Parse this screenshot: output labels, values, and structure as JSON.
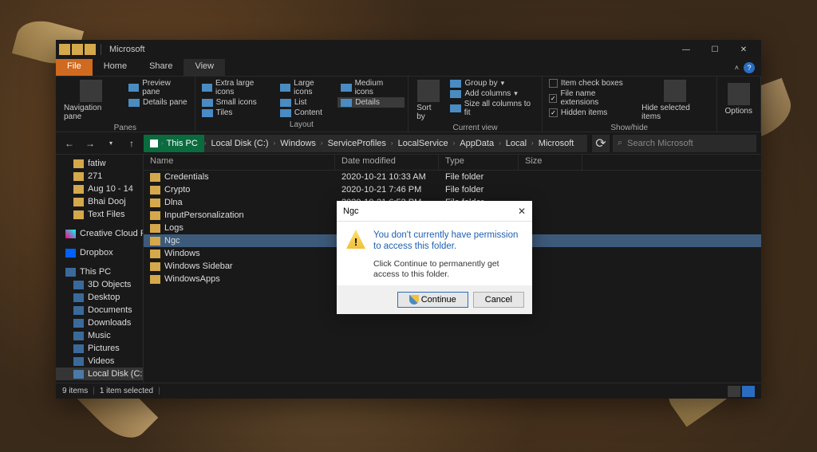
{
  "window": {
    "title": "Microsoft",
    "tabs": [
      "File",
      "Home",
      "Share",
      "View"
    ],
    "active_tab": "View"
  },
  "ribbon": {
    "panes": {
      "nav": "Navigation pane",
      "preview": "Preview pane",
      "details": "Details pane",
      "group_label": "Panes"
    },
    "layout": {
      "xl_icons": "Extra large icons",
      "lg_icons": "Large icons",
      "md_icons": "Medium icons",
      "sm_icons": "Small icons",
      "list": "List",
      "details": "Details",
      "tiles": "Tiles",
      "content": "Content",
      "group_label": "Layout"
    },
    "view": {
      "sort": "Sort by",
      "group": "Group by",
      "add_cols": "Add columns",
      "size_cols": "Size all columns to fit",
      "group_label": "Current view"
    },
    "show": {
      "checkboxes": "Item check boxes",
      "extensions": "File name extensions",
      "hidden": "Hidden items",
      "hide_sel": "Hide selected items",
      "group_label": "Show/hide"
    },
    "options": "Options"
  },
  "breadcrumb": [
    "This PC",
    "Local Disk (C:)",
    "Windows",
    "ServiceProfiles",
    "LocalService",
    "AppData",
    "Local",
    "Microsoft"
  ],
  "search_placeholder": "Search Microsoft",
  "sidebar": {
    "quick": [
      {
        "label": "fatiw"
      },
      {
        "label": "271"
      },
      {
        "label": "Aug 10 - 14"
      },
      {
        "label": "Bhai Dooj"
      },
      {
        "label": "Text Files"
      }
    ],
    "creative": "Creative Cloud Fil",
    "dropbox": "Dropbox",
    "thispc": "This PC",
    "pc_items": [
      {
        "label": "3D Objects"
      },
      {
        "label": "Desktop"
      },
      {
        "label": "Documents"
      },
      {
        "label": "Downloads"
      },
      {
        "label": "Music"
      },
      {
        "label": "Pictures"
      },
      {
        "label": "Videos"
      },
      {
        "label": "Local Disk (C:)"
      }
    ]
  },
  "columns": {
    "name": "Name",
    "date": "Date modified",
    "type": "Type",
    "size": "Size"
  },
  "files": [
    {
      "name": "Credentials",
      "date": "2020-10-21 10:33 AM",
      "type": "File folder"
    },
    {
      "name": "Crypto",
      "date": "2020-10-21 7:46 PM",
      "type": "File folder"
    },
    {
      "name": "Dlna",
      "date": "2020-10-21 6:52 PM",
      "type": "File folder"
    },
    {
      "name": "InputPersonalization",
      "date": "",
      "type": ""
    },
    {
      "name": "Logs",
      "date": "",
      "type": ""
    },
    {
      "name": "Ngc",
      "date": "",
      "type": ""
    },
    {
      "name": "Windows",
      "date": "",
      "type": ""
    },
    {
      "name": "Windows Sidebar",
      "date": "",
      "type": ""
    },
    {
      "name": "WindowsApps",
      "date": "",
      "type": ""
    }
  ],
  "selected_index": 5,
  "status": {
    "items": "9 items",
    "selected": "1 item selected"
  },
  "dialog": {
    "title": "Ngc",
    "heading": "You don't currently have permission to access this folder.",
    "message": "Click Continue to permanently get access to this folder.",
    "continue": "Continue",
    "cancel": "Cancel"
  }
}
